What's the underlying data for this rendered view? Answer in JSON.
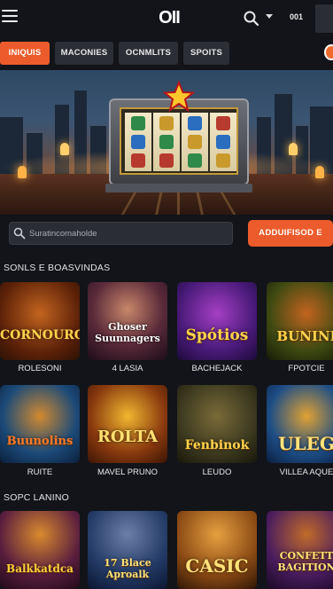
{
  "header": {
    "logo": "OII",
    "account": "001"
  },
  "tabs": [
    {
      "label": "INIQUIS",
      "active": true
    },
    {
      "label": "MACONIES",
      "active": false
    },
    {
      "label": "OCNMLITS",
      "active": false
    },
    {
      "label": "SPOITS",
      "active": false
    }
  ],
  "search": {
    "placeholder": "Suratincomaholde",
    "cta": "ADDUIFISOD E"
  },
  "sections": [
    {
      "title": "SONLS E BOASVINDAS",
      "games": [
        {
          "art": "CORNOURO",
          "label": "ROLESONI"
        },
        {
          "art": "Ghoser Suunnagers",
          "label": "4 LASIA"
        },
        {
          "art": "Spótios",
          "label": "BACHEJACK"
        },
        {
          "art": "BUNINI",
          "label": "FPOTCIE"
        },
        {
          "art": "Buunolins",
          "label": "RUITE"
        },
        {
          "art": "ROLTA",
          "label": "MAVEL PRUNO"
        },
        {
          "art": "Fenbinok",
          "label": "LEUDO"
        },
        {
          "art": "ULEG",
          "label": "VILLEA AQUE"
        }
      ]
    },
    {
      "title": "SOPC LANINO",
      "games": [
        {
          "art": "Balkkatdca",
          "label": ""
        },
        {
          "art": "17 Blace Aproalk",
          "label": ""
        },
        {
          "art": "CASIC",
          "label": ""
        },
        {
          "art": "CONFETT BAGITION",
          "label": ""
        }
      ]
    }
  ],
  "colors": {
    "accent": "#ec5b2b",
    "background": "#121419",
    "tab": "#2b2e35"
  }
}
